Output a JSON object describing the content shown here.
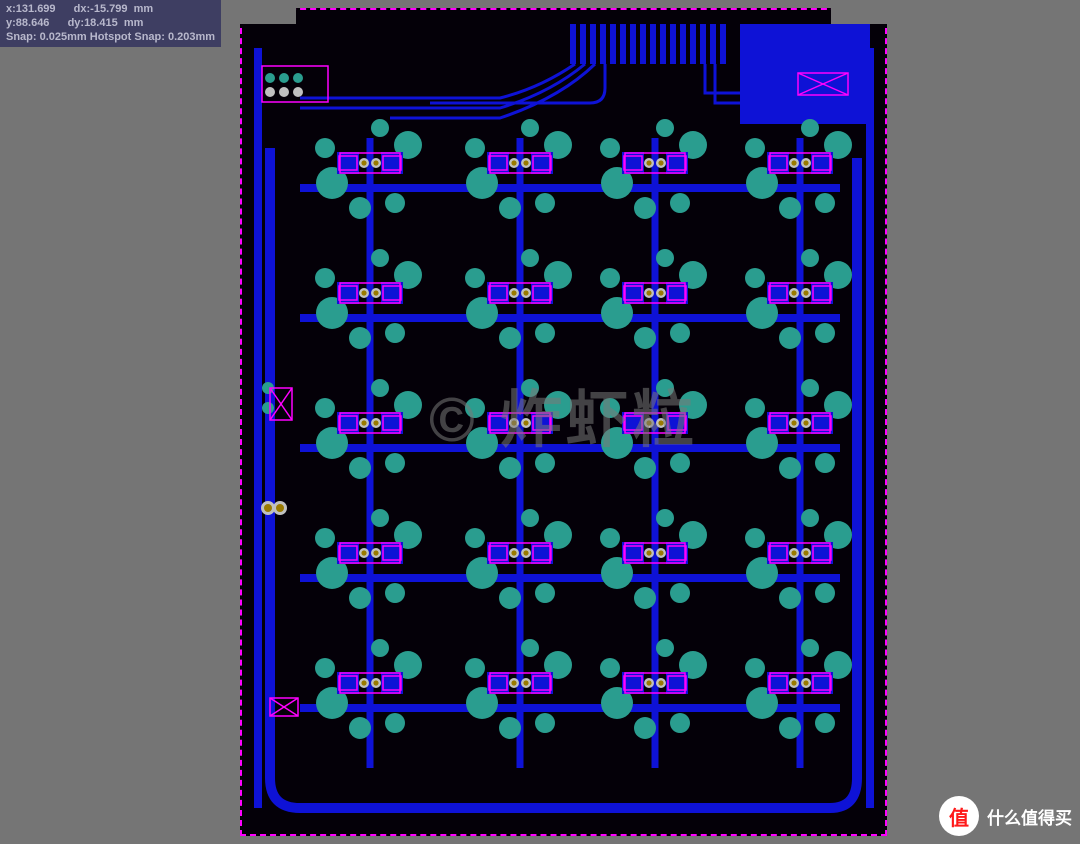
{
  "hud": {
    "x_label": "x:",
    "x_val": "131.699",
    "dx_label": "dx:",
    "dx_val": "-15.799",
    "unit": "mm",
    "y_label": "y:",
    "y_val": "88.646",
    "dy_label": "dy:",
    "dy_val": "18.415",
    "snap_line": "Snap: 0.025mm Hotspot Snap: 0.203mm"
  },
  "watermark": "© 炸虾粒",
  "site_badge": {
    "icon_text": "值",
    "label": "什么值得买"
  },
  "colors": {
    "background_app": "#757575",
    "board_bg": "#040008",
    "copper": "#0e12d6",
    "teal": "#2a9d8f",
    "overlay": "#ff00ff",
    "hud_bg": "#3e3e62"
  },
  "pcb": {
    "size_mm_w": 100,
    "size_mm_h": 128,
    "layers_visible": [
      "top_copper",
      "top_overlay",
      "drill_guide",
      "keepout"
    ],
    "approx_component_grid": "4 columns × 5 rows of repeated switch footprints",
    "connector_area": "edge-fingers top-center, copper pour top-right"
  }
}
